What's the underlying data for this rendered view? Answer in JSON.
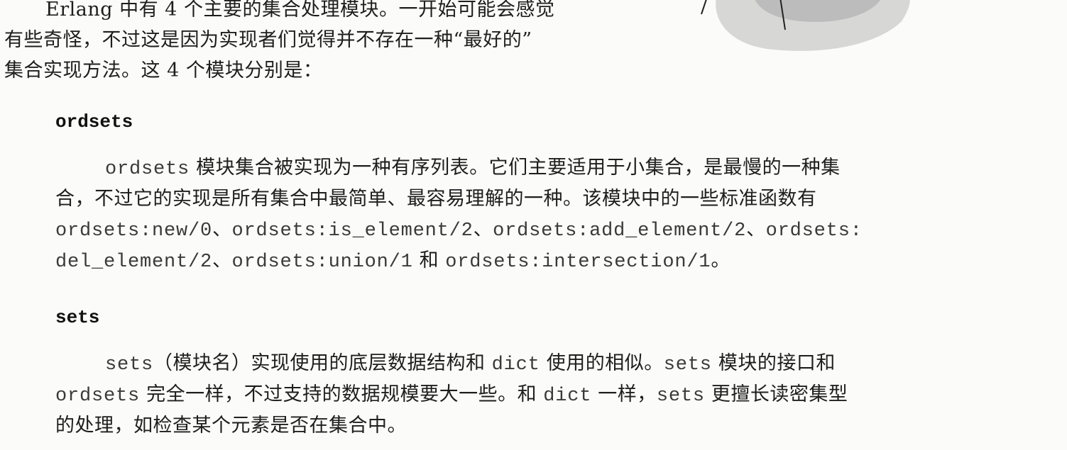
{
  "intro": {
    "line1": "Erlang 中有 4 个主要的集合处理模块。一开始可能会感觉",
    "line2": "有些奇怪，不过这是因为实现者们觉得并不存在一种“最好的”",
    "line3": "集合实现方法。这 4 个模块分别是："
  },
  "ordsets": {
    "heading": "ordsets",
    "l1_code": "ordsets",
    "l1_text": " 模块集合被实现为一种有序列表。它们主要适用于小集合，是最慢的一种集",
    "l2_text": "合，不过它的实现是所有集合中最简单、最容易理解的一种。该模块中的一些标准函数有",
    "l3_c1": "ordsets:new/0",
    "l3_t1": "、",
    "l3_c2": "ordsets:is_element/2",
    "l3_t2": "、",
    "l3_c3": "ordsets:add_element/2",
    "l3_t3": "、",
    "l3_c4": "ordsets:",
    "l4_c1": "del_element/2",
    "l4_t1": "、",
    "l4_c2": "ordsets:union/1",
    "l4_t2": " 和 ",
    "l4_c3": "ordsets:intersection/1",
    "l4_t3": "。"
  },
  "sets": {
    "heading": "sets",
    "l1_c1": "sets",
    "l1_t1": "（模块名）实现使用的底层数据结构和 ",
    "l1_c2": "dict",
    "l1_t2": " 使用的相似。",
    "l1_c3": "sets",
    "l1_t3": " 模块的接口和",
    "l2_c1": "ordsets",
    "l2_t1": " 完全一样，不过支持的数据规模要大一些。和 ",
    "l2_c2": "dict",
    "l2_t2": " 一样，",
    "l2_c3": "sets",
    "l2_t3": " 更擅长读密集型",
    "l3_text": "的处理，如检查某个元素是否在集合中。"
  },
  "colors": {
    "text": "#1e1e1e",
    "code": "#3a3a3a",
    "illustration": "#c9c9c9"
  },
  "icons": {
    "illustration": "partial-cartoon-illustration"
  }
}
